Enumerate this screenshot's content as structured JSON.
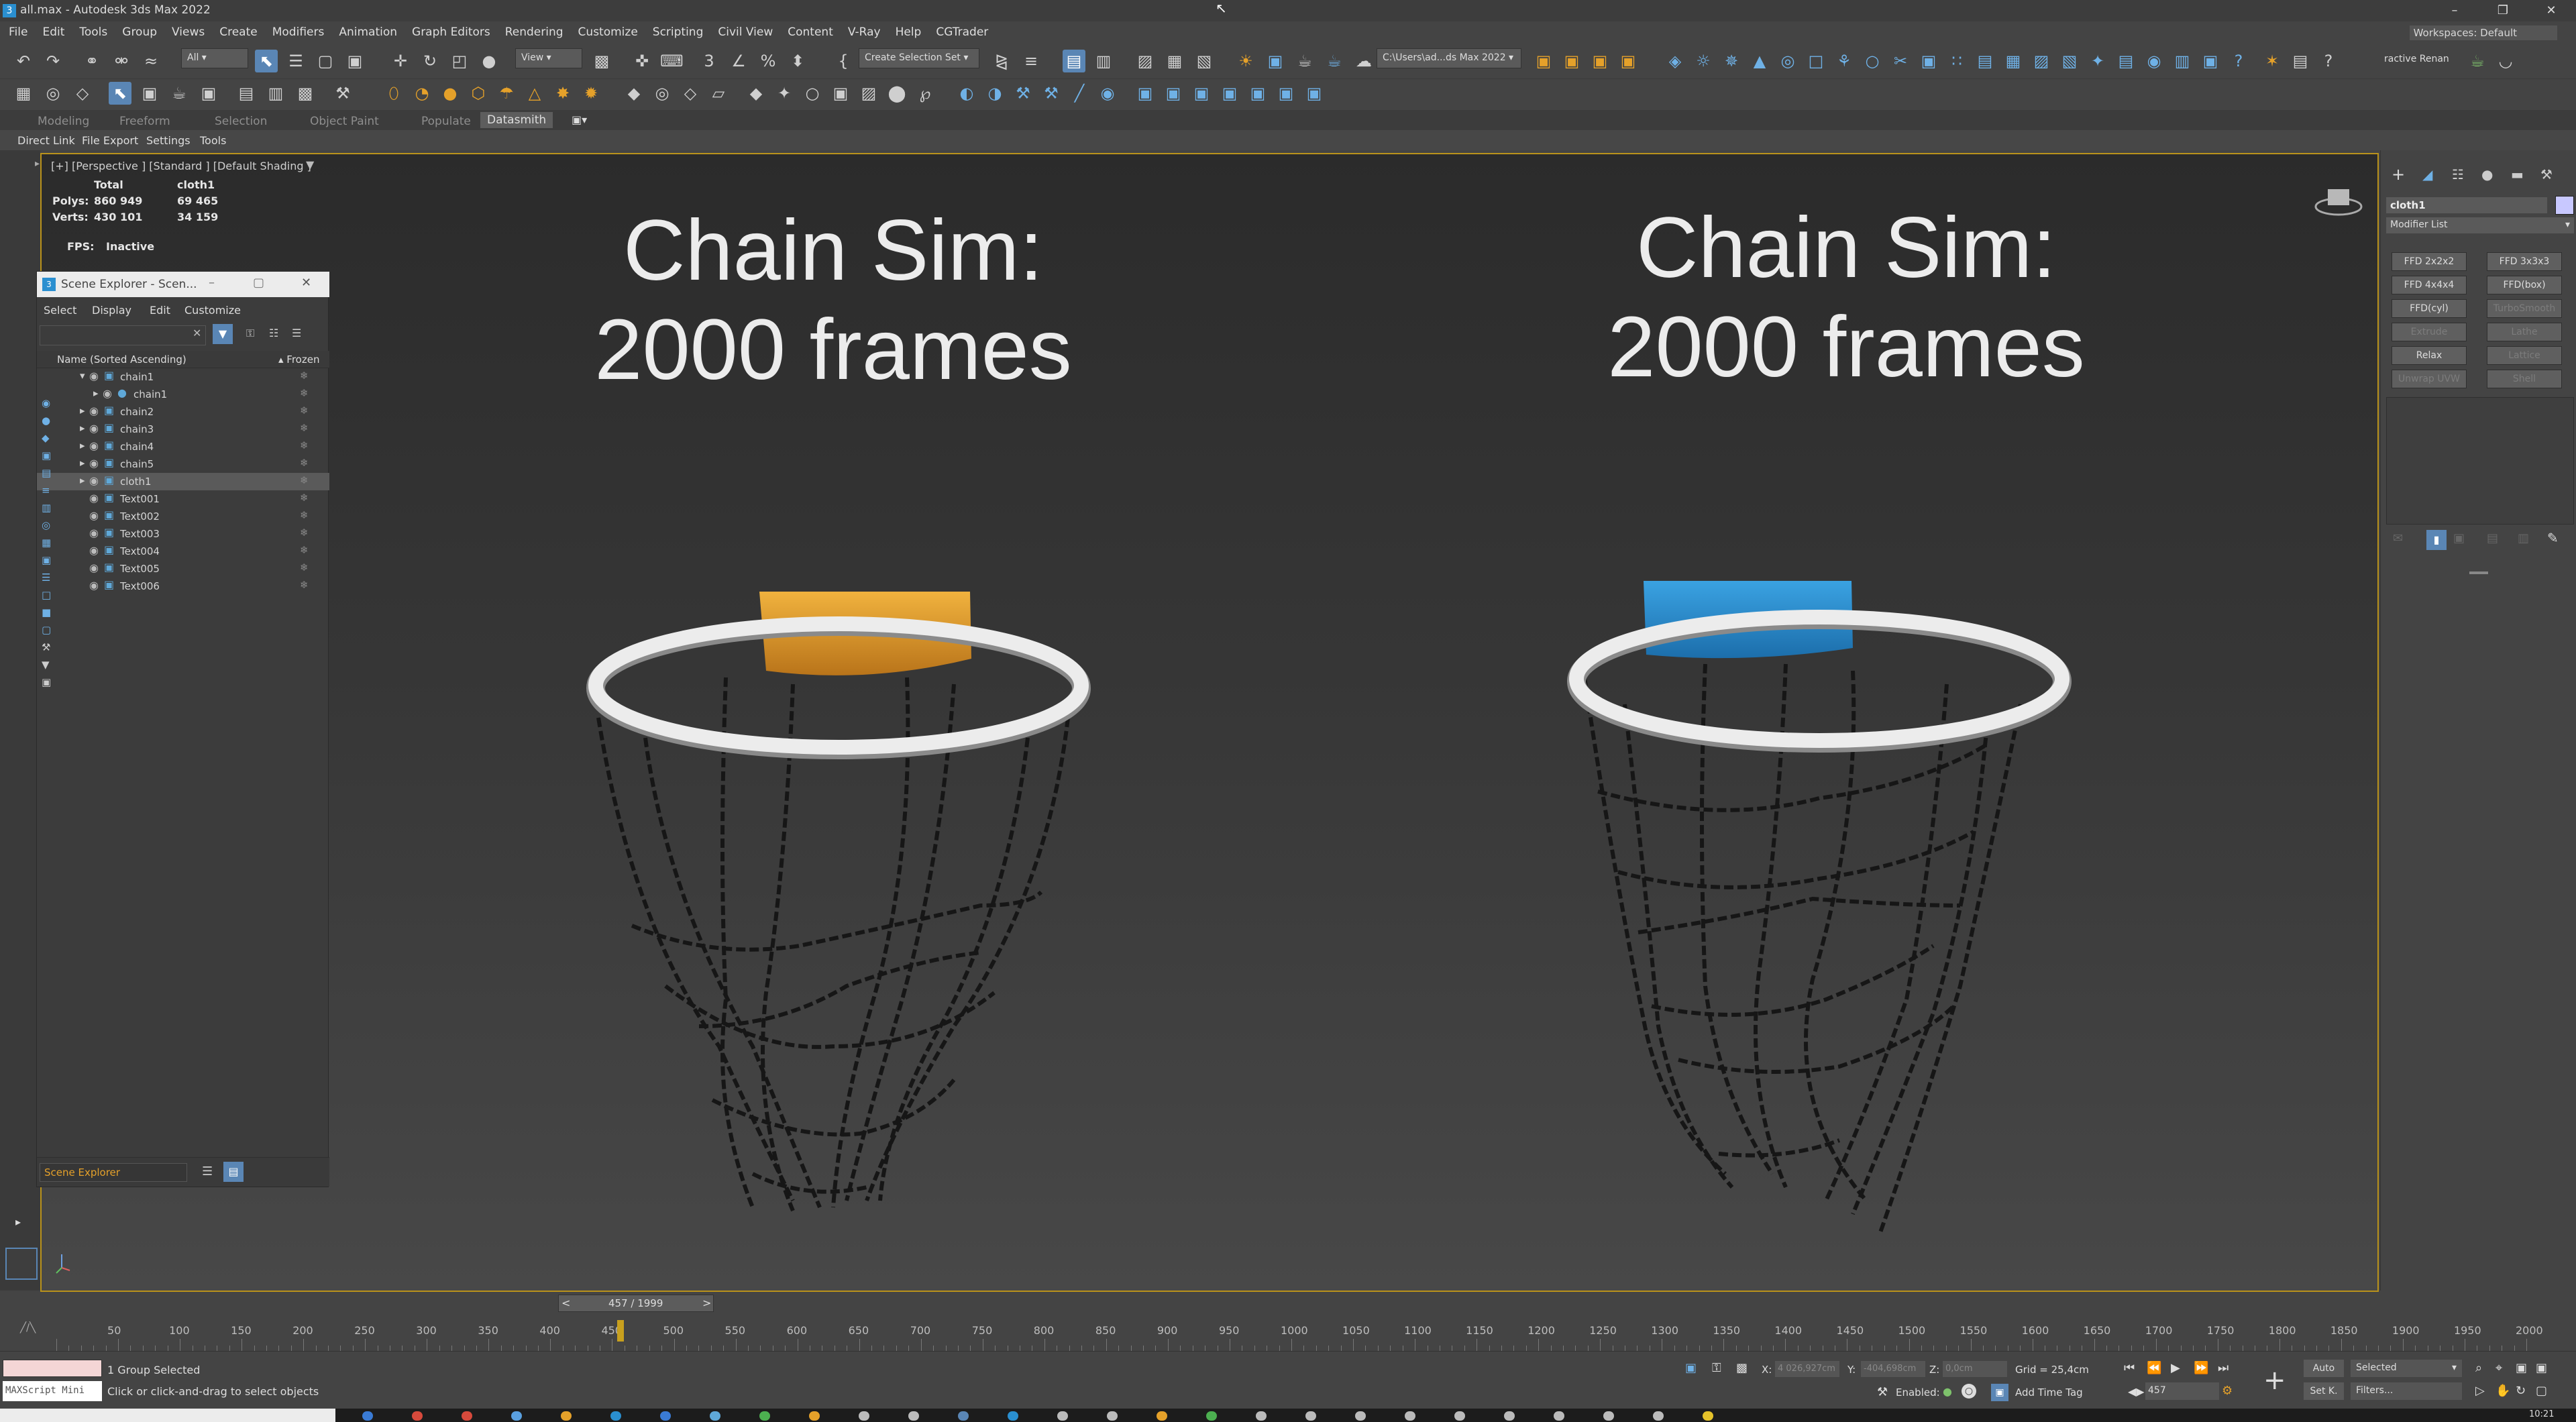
{
  "window": {
    "title": "all.max - Autodesk 3ds Max 2022"
  },
  "menu": [
    "File",
    "Edit",
    "Tools",
    "Group",
    "Views",
    "Create",
    "Modifiers",
    "Animation",
    "Graph Editors",
    "Rendering",
    "Customize",
    "Scripting",
    "Civil View",
    "Content",
    "V-Ray",
    "Help",
    "CGTrader"
  ],
  "workspace": "Workspaces: Default",
  "toolbar": {
    "filter": "All",
    "view": "View",
    "selection_set": "Create Selection Set",
    "path": "C:\\Users\\ad...ds Max 2022",
    "interactive": "ractive Renan"
  },
  "ribbon": {
    "tabs": [
      "Modeling",
      "Freeform",
      "Selection",
      "Object Paint",
      "Populate",
      "Datasmith"
    ],
    "active": "Datasmith"
  },
  "ribbon2": [
    "Direct Link",
    "File Export",
    "Settings",
    "Tools"
  ],
  "viewport": {
    "label": "[+] [Perspective ] [Standard ] [Default Shading ]",
    "stats": {
      "total": "Total",
      "object": "cloth1",
      "polys_label": "Polys:",
      "polys_total": "860 949",
      "polys_obj": "69 465",
      "verts_label": "Verts:",
      "verts_total": "430 101",
      "verts_obj": "34 159",
      "fps_label": "FPS:",
      "fps_value": "Inactive"
    },
    "left_title": [
      "Chain Sim:",
      "2000 frames"
    ],
    "right_title": [
      "Chain Sim:",
      "2000 frames"
    ],
    "colors": {
      "orange_cloth": "#e3a02b",
      "blue_cloth": "#2d8fd1",
      "hoop": "#ececec",
      "chain": "#161616",
      "frame_border": "#b9921b"
    }
  },
  "scene_explorer": {
    "title": "Scene Explorer - Scen...",
    "menus": [
      "Select",
      "Display",
      "Edit",
      "Customize"
    ],
    "col_name": "Name (Sorted Ascending)",
    "col_frozen": "▴ Frozen",
    "rows": [
      {
        "name": "chain1",
        "indent": 0,
        "expand": "▾"
      },
      {
        "name": "chain1",
        "indent": 1,
        "expand": "▸"
      },
      {
        "name": "chain2",
        "indent": 0,
        "expand": "▸"
      },
      {
        "name": "chain3",
        "indent": 0,
        "expand": "▸"
      },
      {
        "name": "chain4",
        "indent": 0,
        "expand": "▸"
      },
      {
        "name": "chain5",
        "indent": 0,
        "expand": "▸"
      },
      {
        "name": "cloth1",
        "indent": 0,
        "expand": "▸",
        "selected": true
      },
      {
        "name": "Text001",
        "indent": 0,
        "expand": ""
      },
      {
        "name": "Text002",
        "indent": 0,
        "expand": ""
      },
      {
        "name": "Text003",
        "indent": 0,
        "expand": ""
      },
      {
        "name": "Text004",
        "indent": 0,
        "expand": ""
      },
      {
        "name": "Text005",
        "indent": 0,
        "expand": ""
      },
      {
        "name": "Text006",
        "indent": 0,
        "expand": ""
      }
    ],
    "footer": "Scene Explorer"
  },
  "command_panel": {
    "object_name": "cloth1",
    "modifier_list": "Modifier List",
    "buttons": [
      [
        "FFD 2x2x2",
        "FFD 3x3x3"
      ],
      [
        "FFD 4x4x4",
        "FFD(box)"
      ],
      [
        "FFD(cyl)",
        "TurboSmooth"
      ],
      [
        "Extrude",
        "Lathe"
      ],
      [
        "Relax",
        "Lattice"
      ],
      [
        "Unwrap UVW",
        "Shell"
      ]
    ],
    "disabled": [
      "TurboSmooth",
      "Extrude",
      "Lathe",
      "Lattice",
      "Unwrap UVW",
      "Shell"
    ]
  },
  "timeline": {
    "frame": "457 / 1999",
    "ticks": [
      "50",
      "100",
      "150",
      "200",
      "250",
      "300",
      "350",
      "400",
      "450",
      "500",
      "550",
      "600",
      "650",
      "700",
      "750",
      "800",
      "850",
      "900",
      "950",
      "1000",
      "1050",
      "1100",
      "1150",
      "1200",
      "1250",
      "1300",
      "1350",
      "1400",
      "1450",
      "1500",
      "1550",
      "1600",
      "1650",
      "1700",
      "1750",
      "1800",
      "1850",
      "1900",
      "1950",
      "2000"
    ],
    "range_end": 2000,
    "current": 457
  },
  "status": {
    "maxscript": "MAXScript Mini",
    "selected": "1 Group Selected",
    "prompt": "Click or click-and-drag to select objects",
    "x_label": "X:",
    "x_value": "4 026,927cm",
    "y_label": "Y:",
    "y_value": "-404,698cm",
    "z_label": "Z:",
    "z_value": "0,0cm",
    "grid": "Grid = 25,4cm",
    "enabled": "Enabled:",
    "add_time_tag": "Add Time Tag",
    "auto": "Auto",
    "setk": "Set K.",
    "selected_dd": "Selected",
    "filters": "Filters...",
    "frame_field": "457",
    "clock": "10:21"
  }
}
